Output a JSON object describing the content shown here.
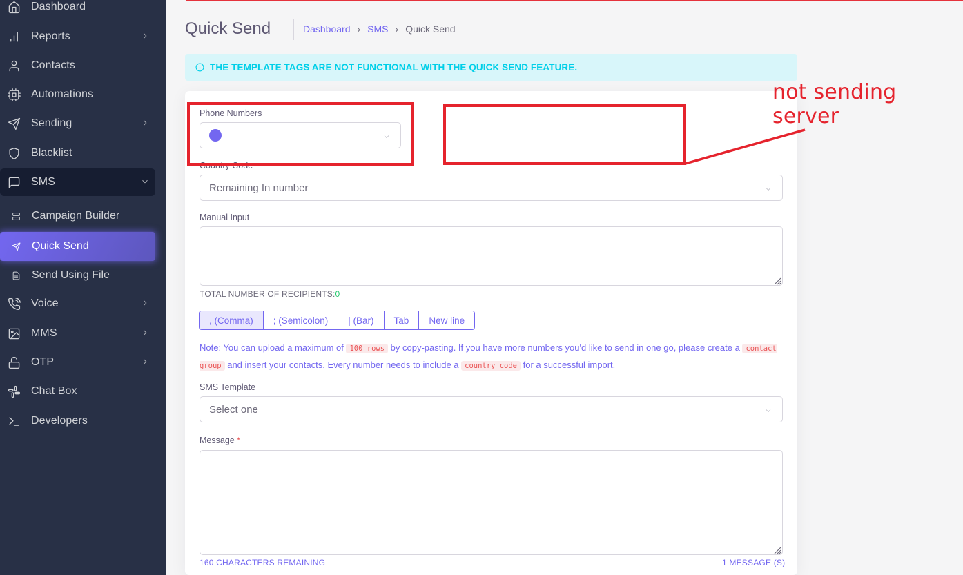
{
  "sidebar": {
    "items": [
      {
        "label": "Dashboard",
        "icon": "home-icon",
        "chevron": false
      },
      {
        "label": "Reports",
        "icon": "bar-chart-icon",
        "chevron": true
      },
      {
        "label": "Contacts",
        "icon": "user-icon",
        "chevron": false
      },
      {
        "label": "Automations",
        "icon": "cpu-icon",
        "chevron": false
      },
      {
        "label": "Sending",
        "icon": "send-icon",
        "chevron": true
      },
      {
        "label": "Blacklist",
        "icon": "shield-icon",
        "chevron": false
      },
      {
        "label": "SMS",
        "icon": "message-square-icon",
        "chevron": true,
        "open": true
      },
      {
        "label": "Voice",
        "icon": "phone-call-icon",
        "chevron": true
      },
      {
        "label": "MMS",
        "icon": "image-icon",
        "chevron": true
      },
      {
        "label": "OTP",
        "icon": "unlock-icon",
        "chevron": true
      },
      {
        "label": "Chat Box",
        "icon": "slack-icon",
        "chevron": false
      },
      {
        "label": "Developers",
        "icon": "terminal-icon",
        "chevron": false
      }
    ],
    "sms_sub": [
      {
        "label": "Campaign Builder",
        "icon": "server-icon"
      },
      {
        "label": "Quick Send",
        "icon": "send-icon",
        "active": true
      },
      {
        "label": "Send Using File",
        "icon": "file-text-icon"
      }
    ]
  },
  "header": {
    "title": "Quick Send",
    "breadcrumb": [
      "Dashboard",
      "SMS",
      "Quick Send"
    ]
  },
  "alert": {
    "text": "THE TEMPLATE TAGS ARE NOT FUNCTIONAL WITH THE QUICK SEND FEATURE."
  },
  "form": {
    "phone_numbers_label": "Phone Numbers",
    "country_code_label": "Country Code",
    "country_code_value": "Remaining In number",
    "manual_input_label": "Manual Input",
    "total_recipients_label": "TOTAL NUMBER OF RECIPIENTS:",
    "total_recipients_value": "0",
    "delimiters": [
      ", (Comma)",
      "; (Semicolon)",
      "| (Bar)",
      "Tab",
      "New line"
    ],
    "note": {
      "part1": "Note: You can upload a maximum of ",
      "code1": "100 rows",
      "part2": " by copy-pasting. If you have more numbers you'd like to send in one go, please create a ",
      "code2": "contact group",
      "part3": " and insert your contacts. Every number needs to include a ",
      "code3": "country code",
      "part4": " for a successful import."
    },
    "sms_template_label": "SMS Template",
    "sms_template_value": "Select one",
    "message_label": "Message",
    "message_required": "*",
    "chars_remaining": "160 CHARACTERS REMAINING",
    "message_count": "1 MESSAGE (S)"
  },
  "annotation": {
    "text": "not sending server"
  },
  "colors": {
    "sidebar_bg": "#283046",
    "primary": "#7367f0",
    "info": "#00cfe8",
    "annotation_red": "#e5232d"
  }
}
